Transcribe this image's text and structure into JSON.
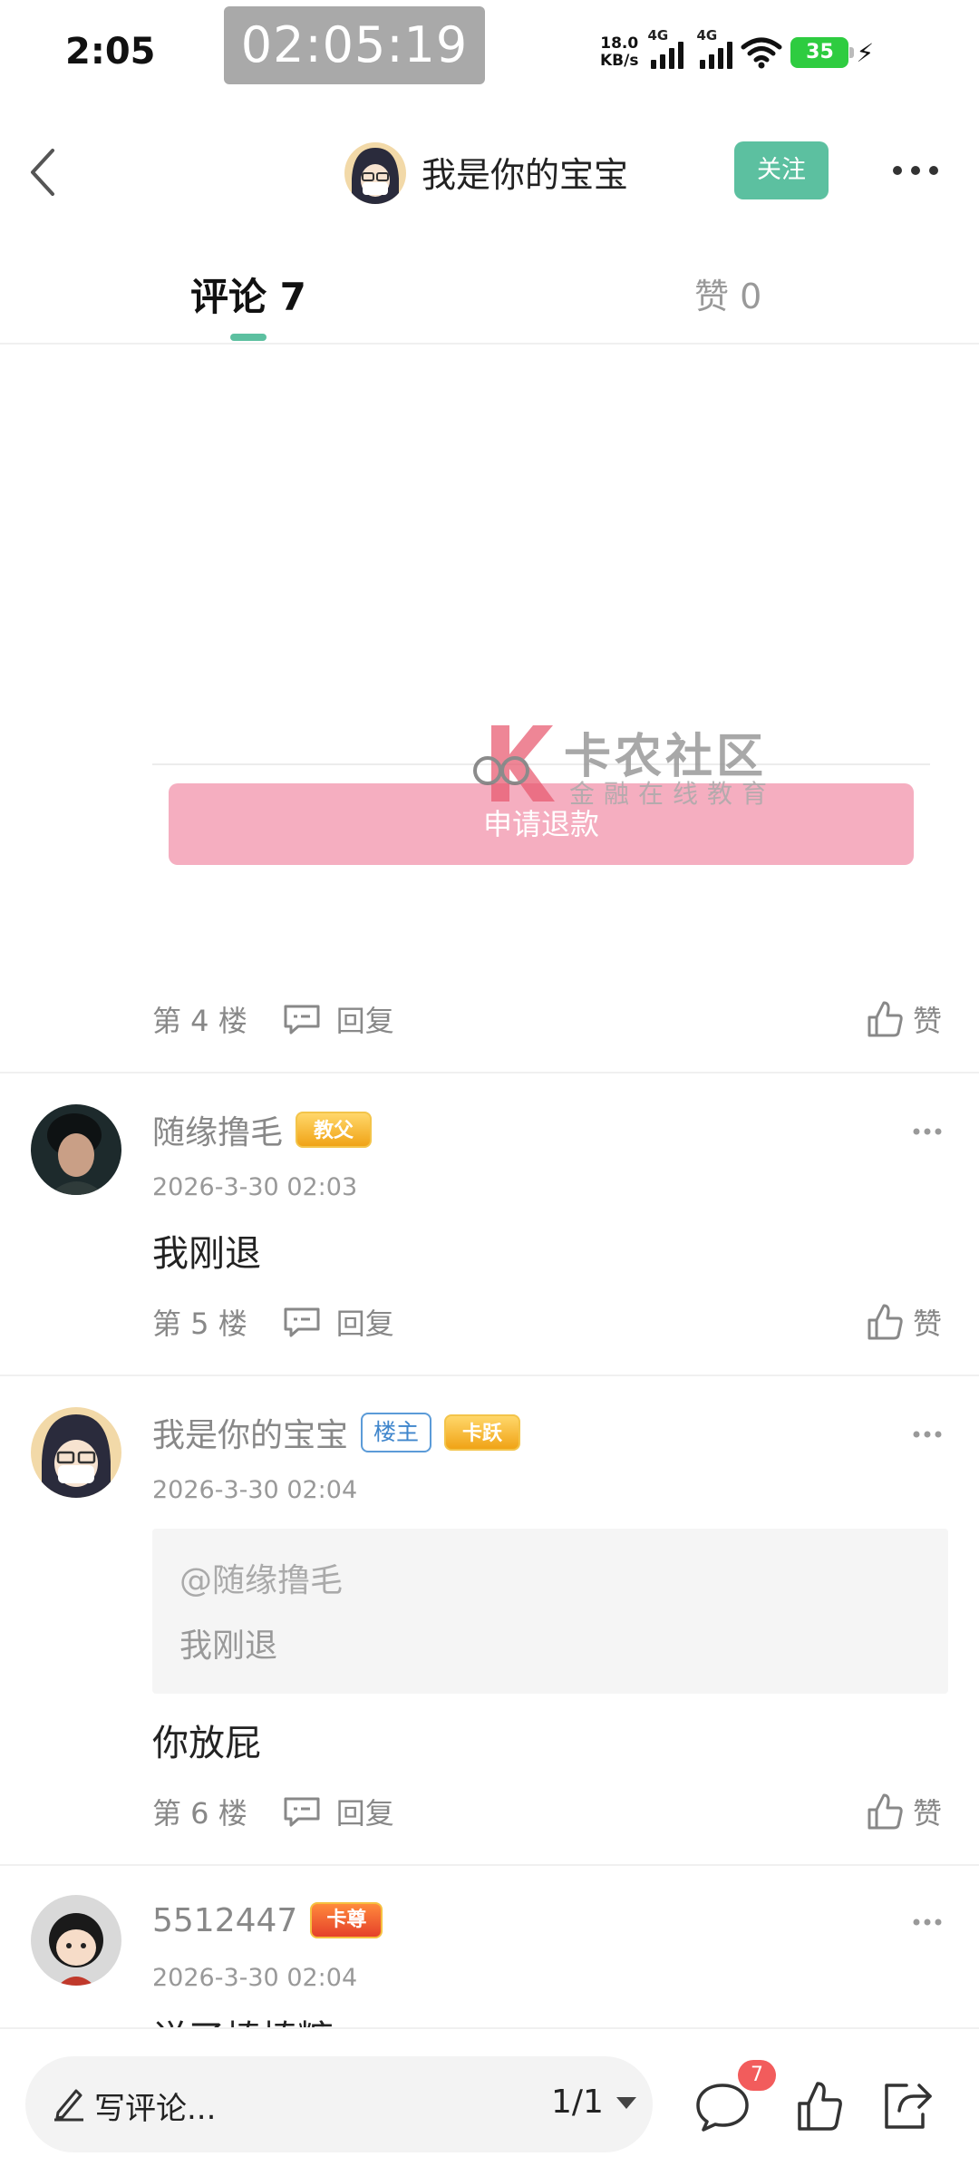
{
  "status_bar": {
    "time": "2:05",
    "timer": "02:05:19",
    "net_speed_value": "18.0",
    "net_speed_unit": "KB/s",
    "signal_label_1": "4G",
    "signal_label_2": "4G",
    "battery": "35"
  },
  "header": {
    "user_name": "我是你的宝宝",
    "follow_label": "关注"
  },
  "tabs": {
    "comments_label": "评论 7",
    "likes_label": "赞 0"
  },
  "post_image": {
    "refund_button": "申请退款",
    "watermark_title": "卡农社区",
    "watermark_subtitle": "金融在线教育"
  },
  "comments": [
    {
      "floor": "第 4 楼",
      "reply_label": "回复",
      "like_label": "赞"
    },
    {
      "name": "随缘撸毛",
      "badge": "教父",
      "time": "2026-3-30 02:03",
      "text": "我刚退",
      "floor": "第 5 楼",
      "reply_label": "回复",
      "like_label": "赞"
    },
    {
      "name": "我是你的宝宝",
      "host_badge": "楼主",
      "badge": "卡跃",
      "time": "2026-3-30 02:04",
      "quote_user": "@随缘撸毛",
      "quote_text": "我刚退",
      "text": "你放屁",
      "floor": "第 6 楼",
      "reply_label": "回复",
      "like_label": "赞"
    },
    {
      "name": "5512447",
      "badge": "卡尊",
      "time": "2026-3-30 02:04",
      "text": "说了棒棒糖"
    }
  ],
  "bottom_bar": {
    "input_placeholder": "写评论...",
    "page": "1/1",
    "comment_count": "7"
  },
  "colors": {
    "accent": "#5cc0a0",
    "refund_button": "#f5aec0",
    "badge_red": "#f25c5c"
  }
}
